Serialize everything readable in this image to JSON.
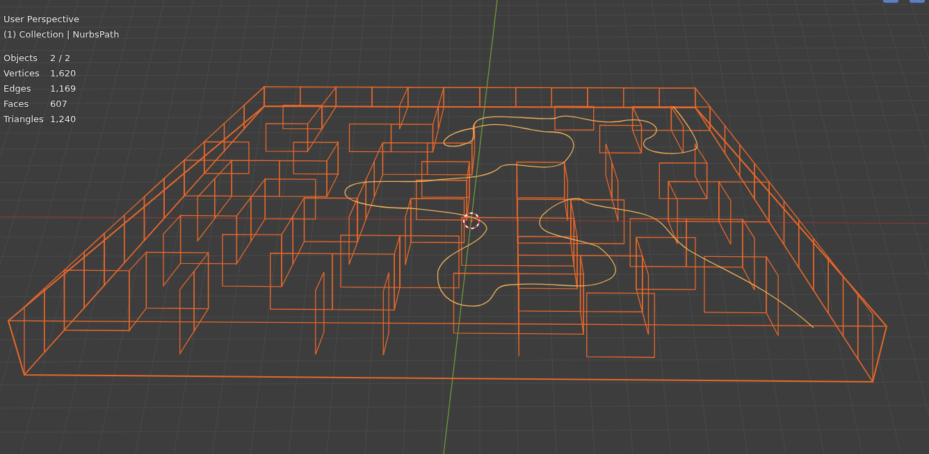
{
  "viewport": {
    "title": "User Perspective",
    "context": "(1) Collection | NurbsPath"
  },
  "stats": [
    {
      "label": "Objects",
      "value": "2 / 2"
    },
    {
      "label": "Vertices",
      "value": "1,620"
    },
    {
      "label": "Edges",
      "value": "1,169"
    },
    {
      "label": "Faces",
      "value": "607"
    },
    {
      "label": "Triangles",
      "value": "1,240"
    }
  ],
  "header_buttons": [
    {
      "selected": true
    },
    {
      "selected": true
    }
  ]
}
